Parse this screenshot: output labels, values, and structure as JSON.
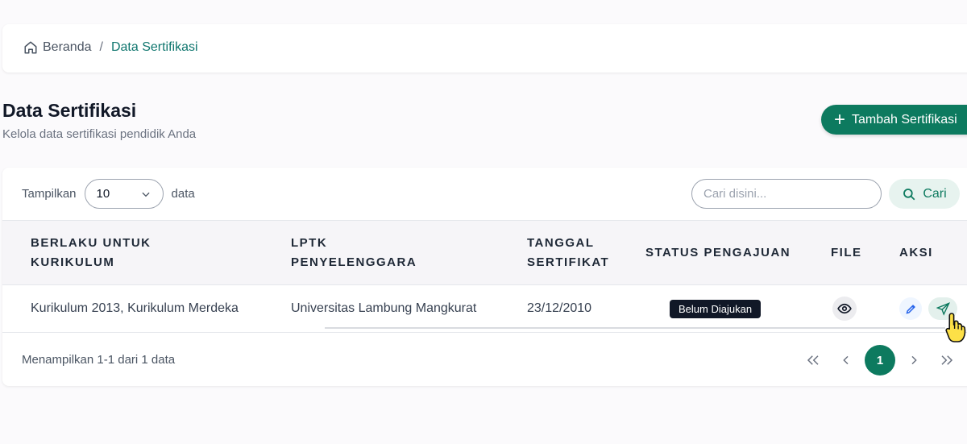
{
  "breadcrumb": {
    "home": "Beranda",
    "separator": "/",
    "current": "Data Sertifikasi"
  },
  "page": {
    "title": "Data Sertifikasi",
    "subtitle": "Kelola data sertifikasi pendidik Anda",
    "add_button": "Tambah Sertifikasi"
  },
  "toolbar": {
    "show_label": "Tampilkan",
    "page_size": "10",
    "data_label": "data",
    "search_placeholder": "Cari disini...",
    "search_button": "Cari"
  },
  "table": {
    "headers": [
      "BERLAKU UNTUK KURIKULUM",
      "LPTK PENYELENGGARA",
      "TANGGAL SERTIFIKAT",
      "STATUS PENGAJUAN",
      "FILE",
      "AKSI"
    ],
    "rows": [
      {
        "kurikulum": "Kurikulum 2013, Kurikulum Merdeka",
        "lptk": "Universitas Lambung Mangkurat",
        "tanggal": "23/12/2010",
        "status": "Belum Diajukan"
      }
    ]
  },
  "footer": {
    "summary": "Menampilkan 1-1 dari 1 data",
    "current_page": "1"
  },
  "colors": {
    "primary": "#0d7a5f",
    "badge": "#111827",
    "edit": "#2563eb"
  }
}
